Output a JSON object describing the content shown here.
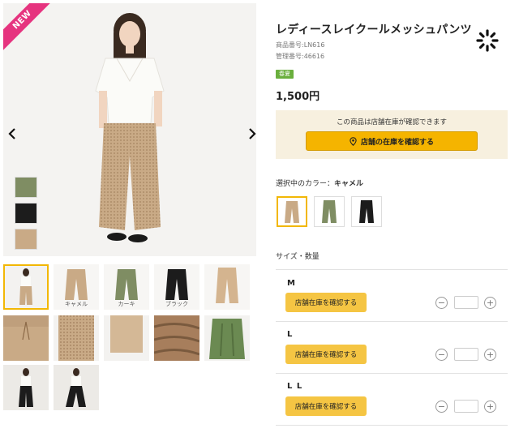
{
  "badge_new": "NEW",
  "product": {
    "title": "レディースレイクールメッシュパンツ",
    "item_number": "商品番号:LN616",
    "manage_number": "管理番号:46616",
    "season_badge": "春夏",
    "price": "1,500円"
  },
  "stock": {
    "note": "この商品は店舗在庫が確認できます",
    "button_label": "店舗の在庫を確認する"
  },
  "color": {
    "label_prefix": "選択中のカラー：",
    "selected_name": "キャメル",
    "options": [
      "camel",
      "khaki",
      "black"
    ]
  },
  "gallery": {
    "captions": [
      "キャメル",
      "カーキ",
      "ブラック"
    ]
  },
  "sizes": {
    "heading": "サイズ・数量",
    "items": [
      {
        "label": "M",
        "button": "店舗在庫を確認する"
      },
      {
        "label": "L",
        "button": "店舗在庫を確認する"
      },
      {
        "label": "L L",
        "button": "店舗在庫を確認する"
      }
    ]
  },
  "colors": {
    "camel": "#c9aa86",
    "khaki": "#7f8d63",
    "black": "#1c1c1c",
    "accent": "#f5b400",
    "new_badge": "#e6347f"
  }
}
